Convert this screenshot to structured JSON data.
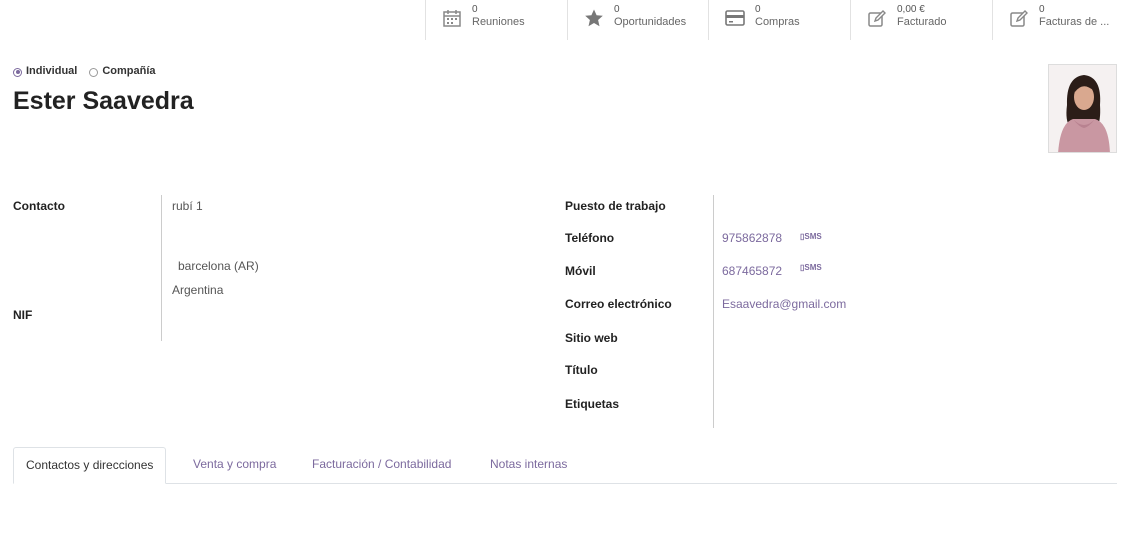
{
  "smart_buttons": [
    {
      "icon": "calendar-icon",
      "value": "0",
      "label": "Reuniones"
    },
    {
      "icon": "star-icon",
      "value": "0",
      "label": "Oportunidades"
    },
    {
      "icon": "credit-card-icon",
      "value": "0",
      "label": "Compras"
    },
    {
      "icon": "pencil-square-icon",
      "value": "0,00 €",
      "label": "Facturado"
    },
    {
      "icon": "pencil-square-icon",
      "value": "0",
      "label": "Facturas de ..."
    }
  ],
  "company_type": {
    "options": [
      "Individual",
      "Compañía"
    ],
    "selected": "Individual"
  },
  "partner_name": "Ester Saavedra",
  "left_fields": {
    "contact_label": "Contacto",
    "street": "rubí 1",
    "city_state": "barcelona (AR)",
    "country": "Argentina",
    "nif_label": "NIF"
  },
  "right_fields": {
    "job_label": "Puesto de trabajo",
    "phone_label": "Teléfono",
    "phone_value": "975862878",
    "mobile_label": "Móvil",
    "mobile_value": "687465872",
    "sms_label": "SMS",
    "email_label": "Correo electrónico",
    "email_value": "Esaavedra@gmail.com",
    "website_label": "Sitio web",
    "title_label": "Título",
    "tags_label": "Etiquetas"
  },
  "tabs": [
    {
      "label": "Contactos y direcciones",
      "active": true
    },
    {
      "label": "Venta y compra",
      "active": false
    },
    {
      "label": "Facturación / Contabilidad",
      "active": false
    },
    {
      "label": "Notas internas",
      "active": false
    }
  ],
  "colors": {
    "accent": "#7c6a9e",
    "text": "#222222",
    "muted": "#555555"
  }
}
